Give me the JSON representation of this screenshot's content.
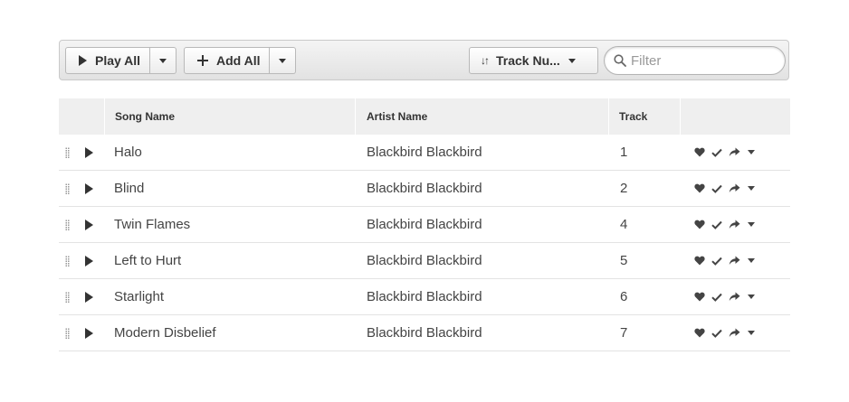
{
  "toolbar": {
    "play_all_label": "Play All",
    "add_all_label": "Add All",
    "sort_label": "Track Nu...",
    "sort_icon": "↓↑",
    "filter_placeholder": "Filter",
    "filter_value": ""
  },
  "table": {
    "columns": {
      "song": "Song Name",
      "artist": "Artist Name",
      "track": "Track"
    },
    "rows": [
      {
        "song": "Halo",
        "artist": "Blackbird Blackbird",
        "track": "1"
      },
      {
        "song": "Blind",
        "artist": "Blackbird Blackbird",
        "track": "2"
      },
      {
        "song": "Twin Flames",
        "artist": "Blackbird Blackbird",
        "track": "4"
      },
      {
        "song": "Left to Hurt",
        "artist": "Blackbird Blackbird",
        "track": "5"
      },
      {
        "song": "Starlight",
        "artist": "Blackbird Blackbird",
        "track": "6"
      },
      {
        "song": "Modern Disbelief",
        "artist": "Blackbird Blackbird",
        "track": "7"
      }
    ],
    "row_actions": [
      "heart-icon",
      "check-icon",
      "share-arrow-icon",
      "chevron-down-icon"
    ]
  },
  "colors": {
    "text": "#444444",
    "header_bg": "#efefef",
    "toolbar_bg": "#e8e8e8"
  }
}
